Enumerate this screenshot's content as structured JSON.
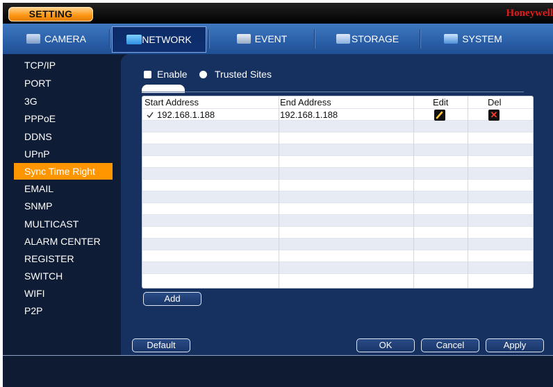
{
  "window": {
    "title": "SETTING",
    "brand": "Honeywell"
  },
  "tabs": [
    {
      "label": "CAMERA",
      "icon": "camera-icon"
    },
    {
      "label": "NETWORK",
      "icon": "network-icon"
    },
    {
      "label": "EVENT",
      "icon": "event-icon"
    },
    {
      "label": "STORAGE",
      "icon": "storage-icon"
    },
    {
      "label": "SYSTEM",
      "icon": "system-icon"
    }
  ],
  "active_tab": "NETWORK",
  "sidebar": {
    "items": [
      {
        "label": "TCP/IP"
      },
      {
        "label": "PORT"
      },
      {
        "label": "3G"
      },
      {
        "label": "PPPoE"
      },
      {
        "label": "DDNS"
      },
      {
        "label": "UPnP"
      },
      {
        "label": "Sync Time Right"
      },
      {
        "label": "EMAIL"
      },
      {
        "label": "SNMP"
      },
      {
        "label": "MULTICAST"
      },
      {
        "label": "ALARM CENTER"
      },
      {
        "label": "REGISTER"
      },
      {
        "label": "SWITCH"
      },
      {
        "label": "WIFI"
      },
      {
        "label": "P2P"
      }
    ],
    "active": "Sync Time Right"
  },
  "options": {
    "enable_label": "Enable",
    "trusted_sites_label": "Trusted Sites"
  },
  "table": {
    "headers": {
      "start": "Start Address",
      "end": "End Address",
      "edit": "Edit",
      "del": "Del"
    },
    "rows": [
      {
        "checked": true,
        "start": "192.168.1.188",
        "end": "192.168.1.188"
      }
    ],
    "del_glyph": "✕"
  },
  "buttons": {
    "add": "Add",
    "default": "Default",
    "ok": "OK",
    "cancel": "Cancel",
    "apply": "Apply"
  },
  "colors": {
    "accent": "#ff9600",
    "brand": "#e11a1a",
    "tab_bar": "#2a5fa8",
    "panel": "#16305f"
  }
}
